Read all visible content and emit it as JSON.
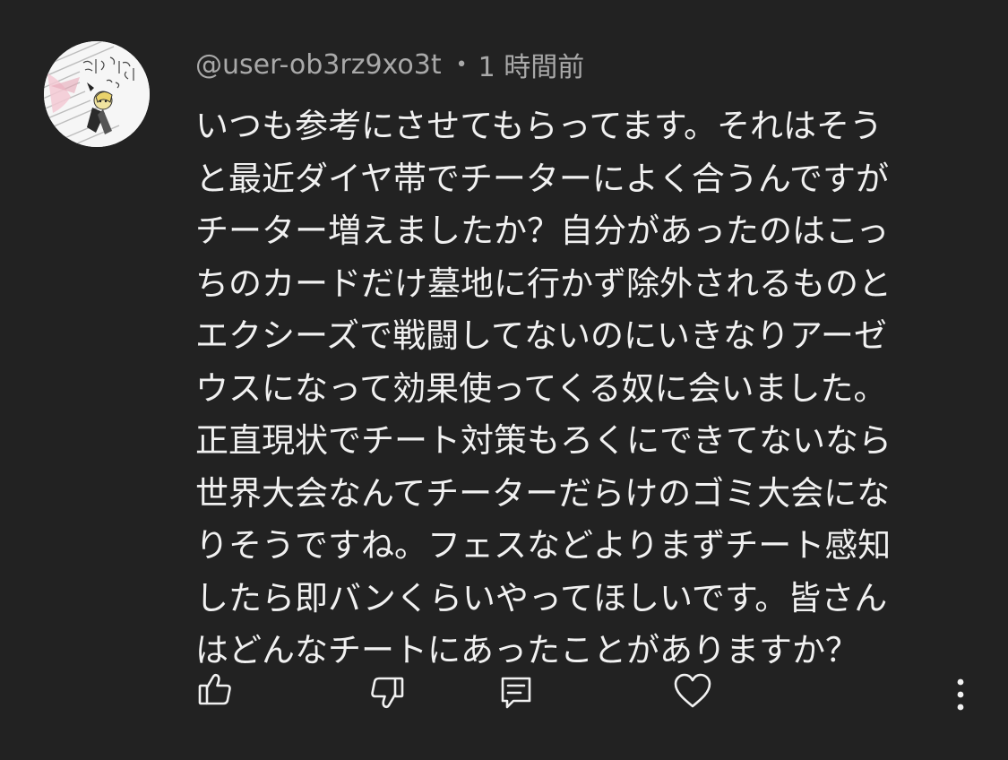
{
  "comment": {
    "author": "@user-ob3rz9xo3t",
    "separator": "•",
    "time": "1 時間前",
    "text": "いつも参考にさせてもらってます。それはそう\nと最近ダイヤ帯でチーターによく合うんですが\nチーター増えましたか？自分があったのはこっ\nちのカードだけ墓地に行かず除外されるものと\nエクシーズで戦闘してないのにいきなりアーゼ\nウスになって効果使ってくる奴に会いました。\n正直現状でチート対策もろくにできてないなら\n世界大会なんてチーターだらけのゴミ大会にな\nりそうですね。フェスなどよりまずチート感知\nしたら即バンくらいやってほしいです。皆さん\nはどんなチートにあったことがありますか？"
  },
  "actions": {
    "like_icon": "thumbs-up-icon",
    "dislike_icon": "thumbs-down-icon",
    "reply_icon": "reply-icon",
    "heart_icon": "heart-icon",
    "more_icon": "more-vertical-icon"
  },
  "colors": {
    "background": "#222222",
    "text": "#f1f1f1",
    "meta": "#a9a9a9"
  }
}
